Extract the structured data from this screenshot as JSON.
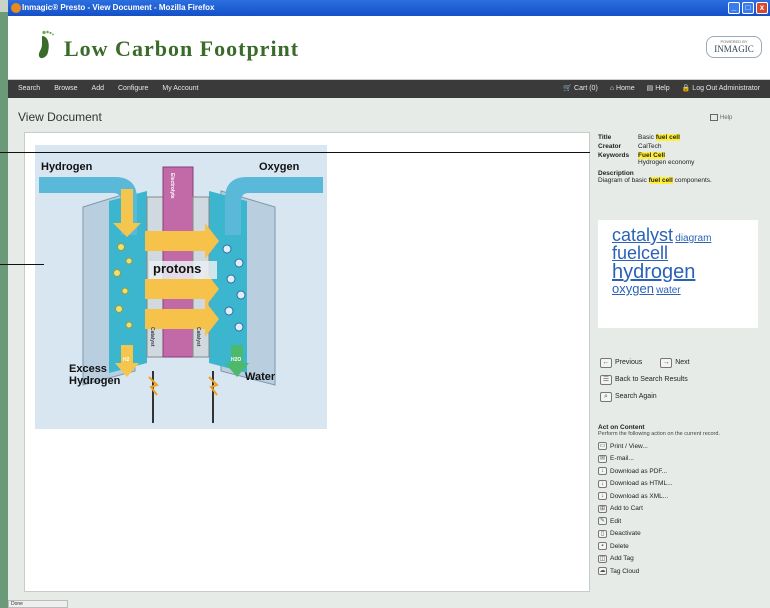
{
  "window": {
    "title": "Inmagic® Presto - View Document - Mozilla Firefox",
    "buttons": [
      "_",
      "□",
      "x"
    ]
  },
  "brand": {
    "name": "Low Carbon Footprint",
    "powered_small": "POWERED BY",
    "powered_name": "INMAGIC"
  },
  "nav": {
    "left": [
      "Search",
      "Browse",
      "Add",
      "Configure",
      "My Account"
    ],
    "right": [
      "Cart (0)",
      "Home",
      "Help",
      "Log Out Administrator"
    ]
  },
  "page": {
    "title": "View Document",
    "help": "Help"
  },
  "figure": {
    "labels": {
      "hydrogen": "Hydrogen",
      "oxygen": "Oxygen",
      "protons": "protons",
      "excess_line1": "Excess",
      "excess_line2": "Hydrogen",
      "water": "Water",
      "electrolyte": "Electrolyte",
      "catalyst": "Catalyst",
      "h2": "H2",
      "h2o": "H2O"
    }
  },
  "metadata": {
    "title_key": "Title",
    "title_prefix": "Basic",
    "title_hl": "fuel cell",
    "creator_key": "Creator",
    "creator_val": "CalTech",
    "keywords_key": "Keywords",
    "keyword1": "Fuel Cell",
    "keyword2": "Hydrogen economy",
    "description_key": "Description",
    "desc_prefix": "Diagram of basic",
    "desc_hl": "fuel cell",
    "desc_suffix": "components."
  },
  "tags": {
    "catalyst": "catalyst",
    "diagram": "diagram",
    "fuelcell": "fuelcell",
    "hydrogen": "hydrogen",
    "oxygen": "oxygen",
    "water": "water"
  },
  "navlinks": {
    "previous": "Previous",
    "next": "Next",
    "back": "Back to Search Results",
    "again": "Search Again"
  },
  "actions": {
    "heading": "Act on Content",
    "subtitle": "Perform the following action on the current record.",
    "items": [
      "Print / View...",
      "E-mail...",
      "Download as PDF...",
      "Download as HTML...",
      "Download as XML...",
      "Add to Cart",
      "Edit",
      "Deactivate",
      "Delete",
      "Add Tag",
      "Tag Cloud"
    ]
  },
  "status": "Done",
  "colors": {
    "titlebar": "#1a5ad8",
    "navbar": "#3a3a3a",
    "brand_green": "#3b6b2a",
    "highlight": "#ffef3a",
    "tag_link": "#2a62b8"
  }
}
